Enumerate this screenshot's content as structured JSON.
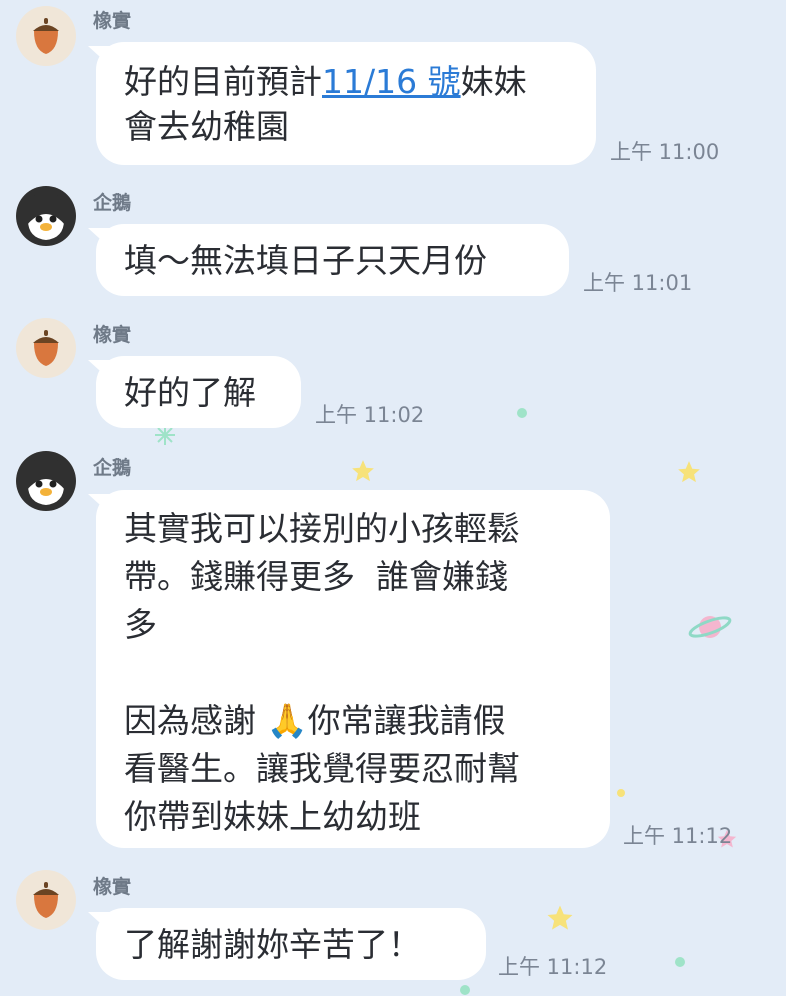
{
  "messages": [
    {
      "sender": "橡實",
      "lines": [
        "好的目前預計",
        "會去幼稚園"
      ],
      "link": "11/16 號",
      "after_link": "妹妹",
      "time": "上午 11:00"
    },
    {
      "sender": "企鵝",
      "lines": [
        "填～無法填日子只天月份"
      ],
      "time": "上午 11:01"
    },
    {
      "sender": "橡實",
      "lines": [
        "好的了解"
      ],
      "time": "上午 11:02"
    },
    {
      "sender": "企鵝",
      "lines": [
        "其實我可以接別的小孩輕鬆",
        "帶。錢賺得更多  誰會嫌錢",
        "多",
        "",
        "因為感謝 🙏你常讓我請假",
        "看醫生。讓我覺得要忍耐幫",
        "你帶到妹妹上幼幼班"
      ],
      "time": "上午 11:12"
    },
    {
      "sender": "橡實",
      "lines": [
        "了解謝謝妳辛苦了！"
      ],
      "time": "上午 11:12"
    }
  ],
  "colors": {
    "background": "#e3ecf7",
    "bubble": "#ffffff",
    "link": "#2b7bd6",
    "text": "#2a2d33"
  },
  "icons": {
    "acorn": "acorn-avatar-icon",
    "penguin": "penguin-avatar-icon"
  }
}
